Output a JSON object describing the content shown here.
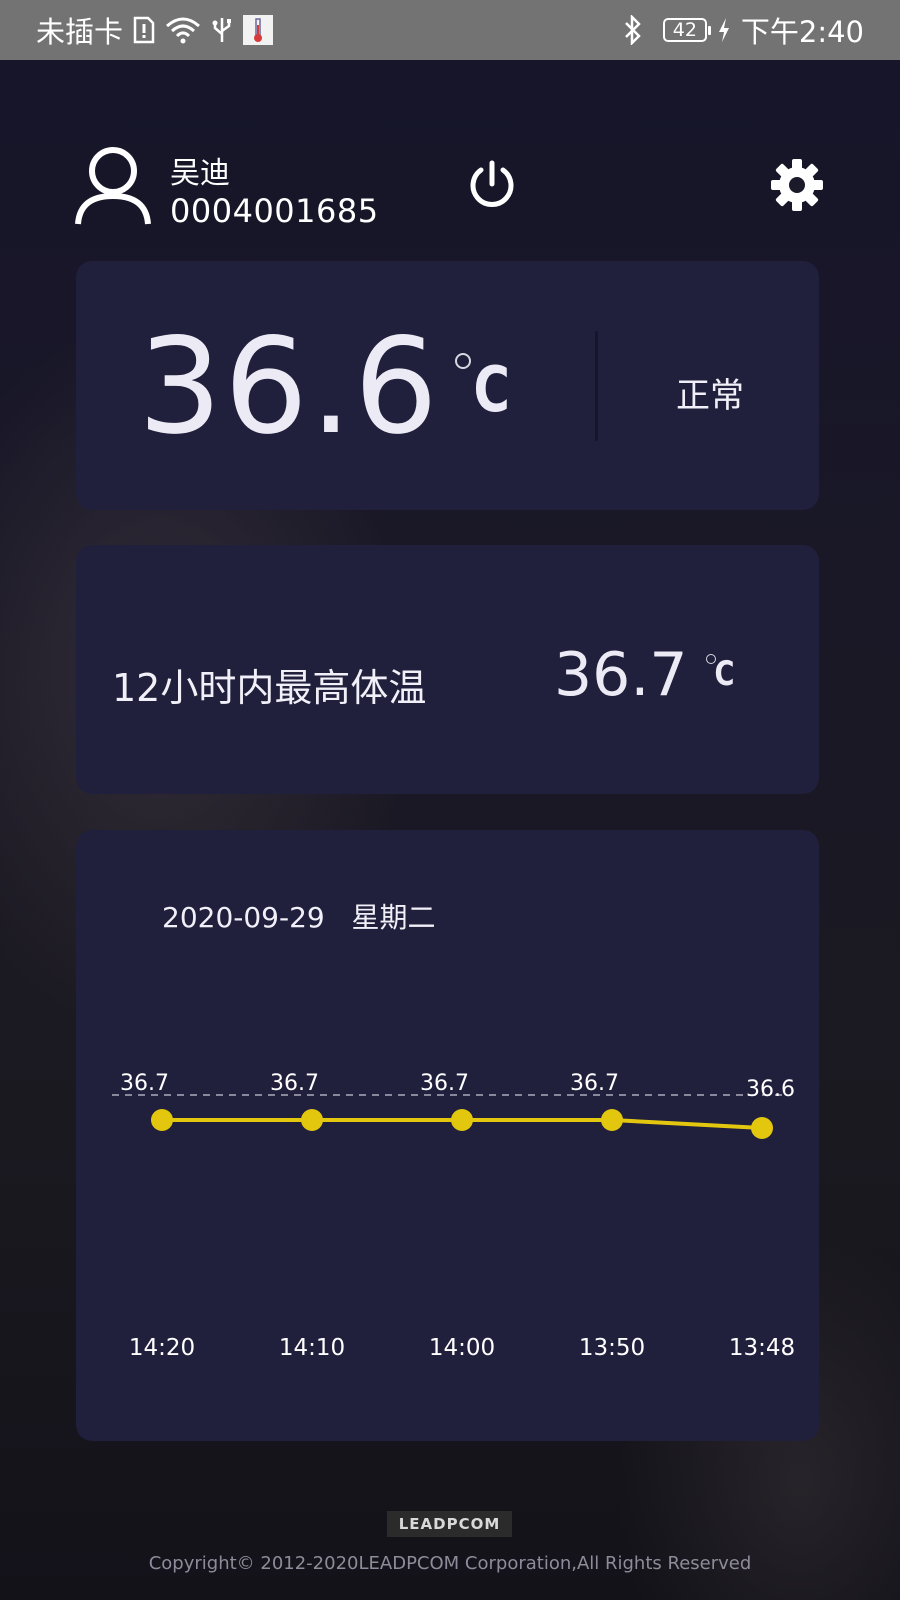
{
  "status_bar": {
    "carrier": "未插卡",
    "battery": "42",
    "time": "下午2:40",
    "icons": [
      "sim-alert-icon",
      "wifi-icon",
      "usb-icon",
      "thermometer-app-icon",
      "bluetooth-icon",
      "charging-icon"
    ]
  },
  "user": {
    "name": "吴迪",
    "id": "0004001685",
    "avatar_icon": "user-icon"
  },
  "header": {
    "power_icon": "power-icon",
    "settings_icon": "gear-icon"
  },
  "current": {
    "temperature": "36.6",
    "unit": "C",
    "status": "正常"
  },
  "max12h": {
    "label": "12小时内最高体温",
    "value": "36.7",
    "unit": "C"
  },
  "chart": {
    "date": "2020-09-29",
    "weekday": "星期二"
  },
  "chart_data": {
    "type": "line",
    "x": [
      "14:20",
      "14:10",
      "14:00",
      "13:50",
      "13:48"
    ],
    "series": [
      {
        "values": [
          36.7,
          36.7,
          36.7,
          36.7,
          36.6
        ]
      }
    ],
    "data_labels": [
      "36.7",
      "36.7",
      "36.7",
      "36.7",
      "36.6"
    ],
    "reference_line": true,
    "colors": {
      "line": "#e3c70f",
      "reference": "#c9c8d6"
    }
  },
  "footer": {
    "logo": "LEADPCOM",
    "copyright": "Copyright© 2012-2020LEADPCOM Corporation,All Rights Reserved"
  },
  "colors": {
    "background": "#15141f",
    "card": "#201f3c",
    "status_bar": "#737373",
    "accent_line": "#e3c70f"
  }
}
